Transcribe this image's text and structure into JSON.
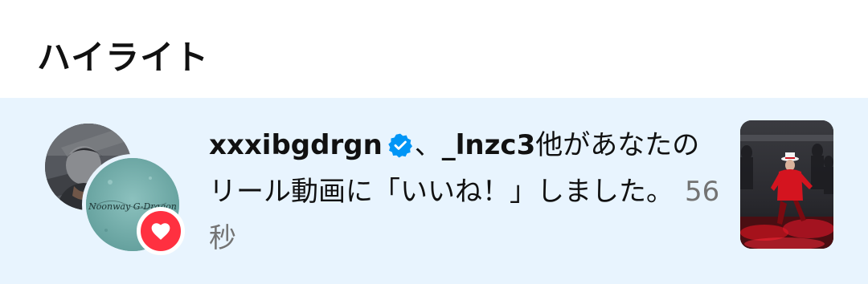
{
  "section": {
    "title": "ハイライト"
  },
  "notification": {
    "user1": "xxxibgdrgn",
    "separator": "、",
    "user2": "_lnzc3",
    "message": "他があなたのリール動画に「いいね！」しました。",
    "timestamp": "56秒",
    "avatar_logo_text": "Noonway G-Dragon"
  },
  "colors": {
    "highlight_background": "#e8f4fe",
    "verified_badge": "#0095f6",
    "like_badge": "#ff3040",
    "timestamp_text": "#737373"
  },
  "icons": {
    "verified": "verified-badge-icon",
    "like": "heart-icon"
  }
}
